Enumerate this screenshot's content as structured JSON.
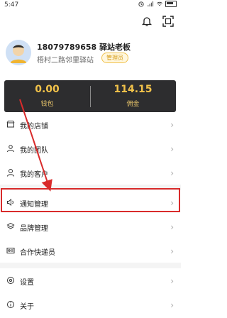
{
  "status_bar": {
    "time": "5:47"
  },
  "profile": {
    "name": "18079789658 驿站老板",
    "subtitle": "梧村二路邻里驿站",
    "badge": "管理员"
  },
  "wallet": {
    "left": {
      "value": "0.00",
      "label": "钱包"
    },
    "right": {
      "value": "114.15",
      "label": "佣金"
    }
  },
  "menu": {
    "items": [
      {
        "label": "我的店铺",
        "icon": "store-icon"
      },
      {
        "label": "我的团队",
        "icon": "team-icon"
      },
      {
        "label": "我的客户",
        "icon": "person-icon"
      },
      {
        "label": "通知管理",
        "icon": "speaker-icon"
      },
      {
        "label": "品牌管理",
        "icon": "layers-icon"
      },
      {
        "label": "合作快递员",
        "icon": "id-card-icon"
      },
      {
        "label": "设置",
        "icon": "settings-icon"
      },
      {
        "label": "关于",
        "icon": "info-icon"
      }
    ]
  },
  "colors": {
    "accent": "#f1c24a",
    "highlight": "#d92b2b",
    "wallet_bg": "#2d2d2f"
  }
}
